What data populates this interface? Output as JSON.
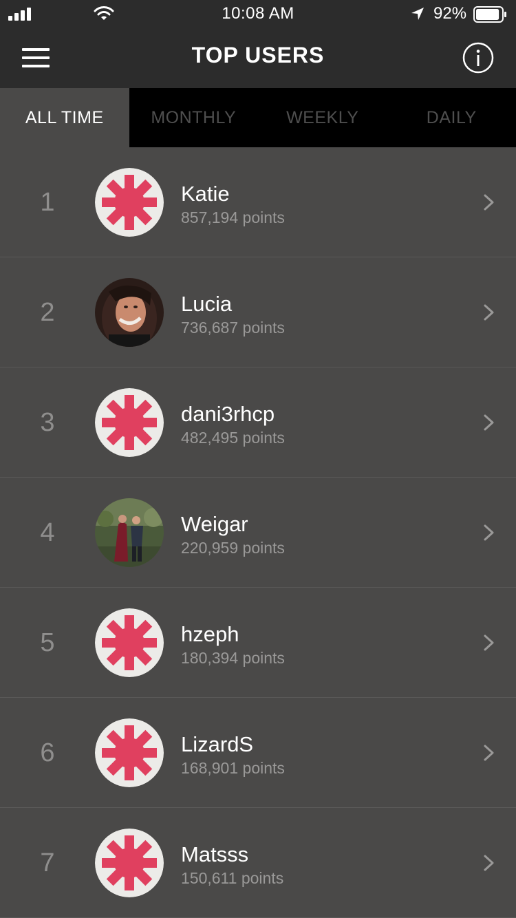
{
  "status_bar": {
    "time": "10:08 AM",
    "battery_percent": "92%",
    "battery_level": 0.92,
    "icons": [
      "signal-icon",
      "wifi-icon",
      "location-arrow-icon",
      "battery-icon"
    ]
  },
  "header": {
    "title": "TOP USERS",
    "menu_icon": "hamburger-menu-icon",
    "info_icon": "info-icon"
  },
  "tabs": [
    {
      "label": "ALL TIME",
      "active": true
    },
    {
      "label": "MONTHLY",
      "active": false
    },
    {
      "label": "WEEKLY",
      "active": false
    },
    {
      "label": "DAILY",
      "active": false
    }
  ],
  "users": [
    {
      "rank": "1",
      "name": "Katie",
      "points": "857,194 points",
      "avatar": "asterisk-logo"
    },
    {
      "rank": "2",
      "name": "Lucia",
      "points": "736,687 points",
      "avatar": "photo"
    },
    {
      "rank": "3",
      "name": "dani3rhcp",
      "points": "482,495 points",
      "avatar": "asterisk-logo"
    },
    {
      "rank": "4",
      "name": "Weigar",
      "points": "220,959 points",
      "avatar": "photo"
    },
    {
      "rank": "5",
      "name": "hzeph",
      "points": "180,394 points",
      "avatar": "asterisk-logo"
    },
    {
      "rank": "6",
      "name": "LizardS",
      "points": "168,901 points",
      "avatar": "asterisk-logo"
    },
    {
      "rank": "7",
      "name": "Matsss",
      "points": "150,611 points",
      "avatar": "asterisk-logo"
    }
  ],
  "colors": {
    "accent_red": "#e0405f",
    "avatar_bg": "#ecebe8",
    "header_bg": "#2c2c2c",
    "list_bg": "#4a4948"
  }
}
